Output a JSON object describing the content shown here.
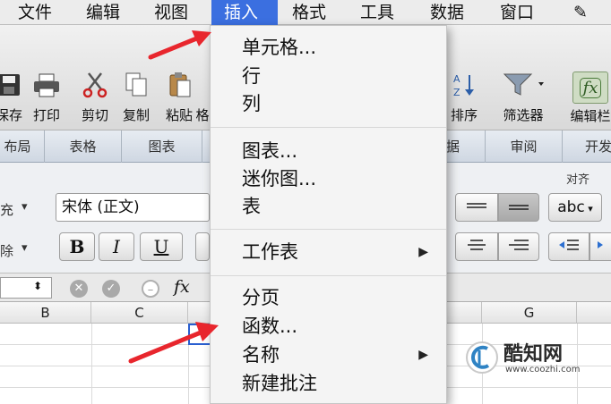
{
  "menubar": {
    "items": [
      "文件",
      "编辑",
      "视图",
      "插入",
      "格式",
      "工具",
      "数据",
      "窗口"
    ],
    "active_index": 3
  },
  "toolbar": {
    "items": [
      {
        "label": "保存",
        "icon": "save-icon"
      },
      {
        "label": "打印",
        "icon": "print-icon"
      },
      {
        "label": "剪切",
        "icon": "scissors-icon"
      },
      {
        "label": "复制",
        "icon": "copy-icon"
      },
      {
        "label": "粘贴",
        "icon": "paste-icon"
      },
      {
        "label": "格",
        "icon": "format-icon"
      },
      {
        "label": "排序",
        "icon": "sort-icon"
      },
      {
        "label": "筛选器",
        "icon": "filter-icon"
      },
      {
        "label": "编辑栏",
        "icon": "fx-icon"
      }
    ]
  },
  "ribbon": {
    "tabs": [
      "布局",
      "表格",
      "图表",
      "据",
      "审阅",
      "开发"
    ]
  },
  "format": {
    "font_name": "宋体 (正文)",
    "left_labels": [
      "充",
      "除"
    ],
    "bold": "B",
    "italic": "I",
    "underline": "U",
    "align_group_label": "对齐",
    "wrap_button": "abc"
  },
  "formula_bar": {
    "fx": "fx"
  },
  "grid": {
    "columns": [
      "B",
      "C",
      "G"
    ]
  },
  "dropdown": {
    "groups": [
      [
        {
          "label": "单元格...",
          "submenu": false
        },
        {
          "label": "行",
          "submenu": false
        },
        {
          "label": "列",
          "submenu": false
        }
      ],
      [
        {
          "label": "图表...",
          "submenu": false
        },
        {
          "label": "迷你图...",
          "submenu": false
        },
        {
          "label": "表",
          "submenu": false
        }
      ],
      [
        {
          "label": "工作表",
          "submenu": true
        }
      ],
      [
        {
          "label": "分页",
          "submenu": false
        },
        {
          "label": "函数...",
          "submenu": false
        },
        {
          "label": "名称",
          "submenu": true
        },
        {
          "label": "新建批注",
          "submenu": false
        }
      ]
    ]
  },
  "watermark": {
    "brand": "酷知网",
    "url": "www.coozhi.com"
  },
  "colors": {
    "menu_highlight": "#3b6fe0",
    "arrow": "#e8262d",
    "watermark_blue": "#2f83c4"
  }
}
